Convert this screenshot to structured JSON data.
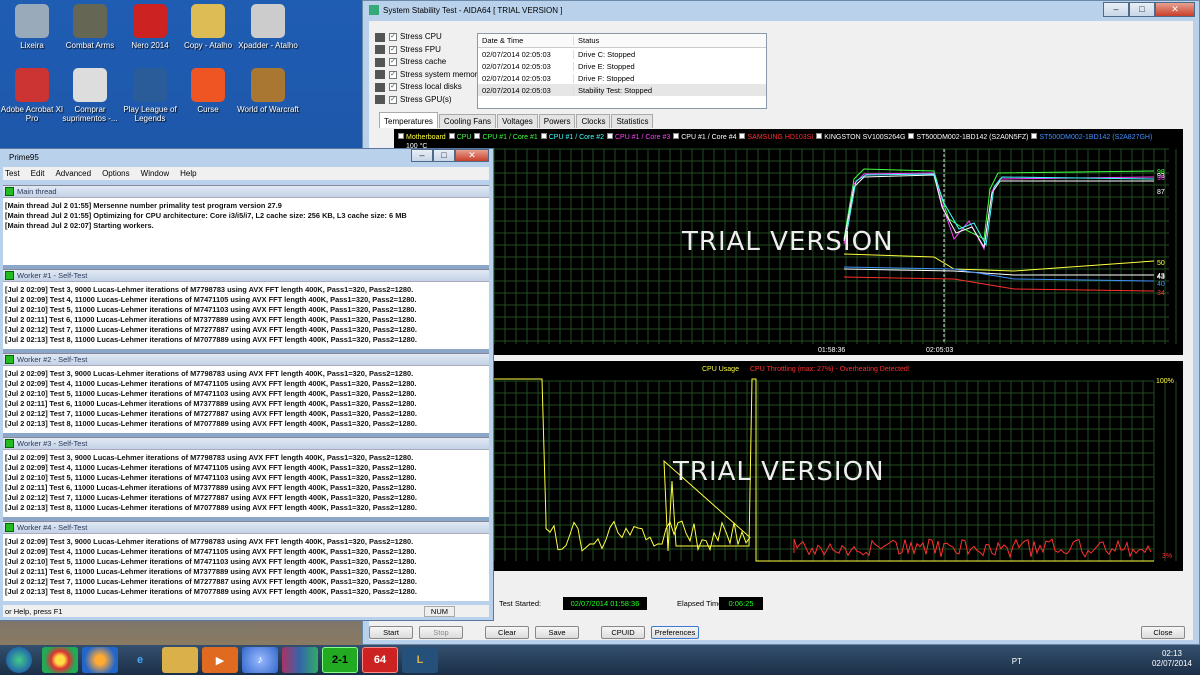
{
  "desktop": {
    "icons": [
      {
        "label": "Lixeira",
        "color": "#9ab"
      },
      {
        "label": "Combat Arms",
        "color": "#665"
      },
      {
        "label": "Nero 2014",
        "color": "#c22"
      },
      {
        "label": "Copy - Atalho",
        "color": "#db5"
      },
      {
        "label": "Xpadder - Atalho",
        "color": "#ccc"
      },
      {
        "label": "Adobe Acrobat XI Pro",
        "color": "#c33"
      },
      {
        "label": "Comprar suprimentos -...",
        "color": "#ddd"
      },
      {
        "label": "Play League of Legends",
        "color": "#2a5c9a"
      },
      {
        "label": "Curse",
        "color": "#e52"
      },
      {
        "label": "World of Warcraft",
        "color": "#a73"
      }
    ]
  },
  "aida": {
    "title": "System Stability Test - AIDA64  [ TRIAL VERSION ]",
    "stress": [
      "Stress CPU",
      "Stress FPU",
      "Stress cache",
      "Stress system memory",
      "Stress local disks",
      "Stress GPU(s)"
    ],
    "log_headers": [
      "Date & Time",
      "Status"
    ],
    "log": [
      [
        "02/07/2014 02:05:03",
        "Drive C: Stopped"
      ],
      [
        "02/07/2014 02:05:03",
        "Drive E: Stopped"
      ],
      [
        "02/07/2014 02:05:03",
        "Drive F: Stopped"
      ],
      [
        "02/07/2014 02:05:03",
        "Stability Test: Stopped"
      ]
    ],
    "tabs": [
      "Temperatures",
      "Cooling Fans",
      "Voltages",
      "Powers",
      "Clocks",
      "Statistics"
    ],
    "legend": [
      {
        "label": "Motherboard",
        "color": "#ffff40"
      },
      {
        "label": "CPU",
        "color": "#40ff40"
      },
      {
        "label": "CPU #1 / Core #1",
        "color": "#40ff40"
      },
      {
        "label": "CPU #1 / Core #2",
        "color": "#40ffff"
      },
      {
        "label": "CPU #1 / Core #3",
        "color": "#ff40ff"
      },
      {
        "label": "CPU #1 / Core #4",
        "color": "#ffffff"
      },
      {
        "label": "SAMSUNG HD103SI",
        "color": "#ff3030"
      },
      {
        "label": "KINGSTON SV100S264G",
        "color": "#ffffff"
      },
      {
        "label": "ST500DM002-1BD142 (S2A0N5FZ)",
        "color": "#ffffff"
      },
      {
        "label": "ST500DM002-1BD142 (S2A827GH)",
        "color": "#4090ff"
      }
    ],
    "temp_axis_top": "100 °C",
    "temp_times": [
      "01:58:36",
      "02:05:03"
    ],
    "temp_values": [
      "98",
      "93",
      "95",
      "87",
      "50",
      "43",
      "43",
      "40",
      "34"
    ],
    "trial_text": "TRIAL VERSION",
    "cpu_legend_usage": "CPU Usage",
    "cpu_legend_throttle": "CPU Throttling (max: 27%) - Overheating Detected!",
    "cpu_top": "100%",
    "cpu_bottom": "3%",
    "test_started_label": "Test Started:",
    "test_started": "02/07/2014 01:58:36",
    "elapsed_label": "Elapsed Time:",
    "elapsed": "0:06:25",
    "buttons": [
      "Start",
      "Stop",
      "Clear",
      "Save",
      "CPUID",
      "Preferences",
      "Close"
    ]
  },
  "prime": {
    "title": "Prime95",
    "menu": [
      "Test",
      "Edit",
      "Advanced",
      "Options",
      "Window",
      "Help"
    ],
    "main_title": "Main thread",
    "main_lines": [
      "[Main thread Jul 2 01:55] Mersenne number primality test program version 27.9",
      "[Main thread Jul 2 01:55] Optimizing for CPU architecture: Core i3/i5/i7, L2 cache size: 256 KB, L3 cache size: 6 MB",
      "[Main thread Jul 2 02:07] Starting workers."
    ],
    "workers": [
      {
        "title": "Worker #1 - Self-Test"
      },
      {
        "title": "Worker #2 - Self-Test"
      },
      {
        "title": "Worker #3 - Self-Test"
      },
      {
        "title": "Worker #4 - Self-Test"
      }
    ],
    "worker_lines": [
      "[Jul 2 02:09] Test 3, 9000 Lucas-Lehmer iterations of M7798783 using AVX FFT length 400K, Pass1=320, Pass2=1280.",
      "[Jul 2 02:09] Test 4, 11000 Lucas-Lehmer iterations of M7471105 using AVX FFT length 400K, Pass1=320, Pass2=1280.",
      "[Jul 2 02:10] Test 5, 11000 Lucas-Lehmer iterations of M7471103 using AVX FFT length 400K, Pass1=320, Pass2=1280.",
      "[Jul 2 02:11] Test 6, 11000 Lucas-Lehmer iterations of M7377889 using AVX FFT length 400K, Pass1=320, Pass2=1280.",
      "[Jul 2 02:12] Test 7, 11000 Lucas-Lehmer iterations of M7277887 using AVX FFT length 400K, Pass1=320, Pass2=1280.",
      "[Jul 2 02:13] Test 8, 11000 Lucas-Lehmer iterations of M7077889 using AVX FFT length 400K, Pass1=320, Pass2=1280."
    ],
    "status": "or Help, press F1",
    "num": "NUM"
  },
  "taskbar": {
    "lang": "PT",
    "time": "02:13",
    "date": "02/07/2014"
  }
}
